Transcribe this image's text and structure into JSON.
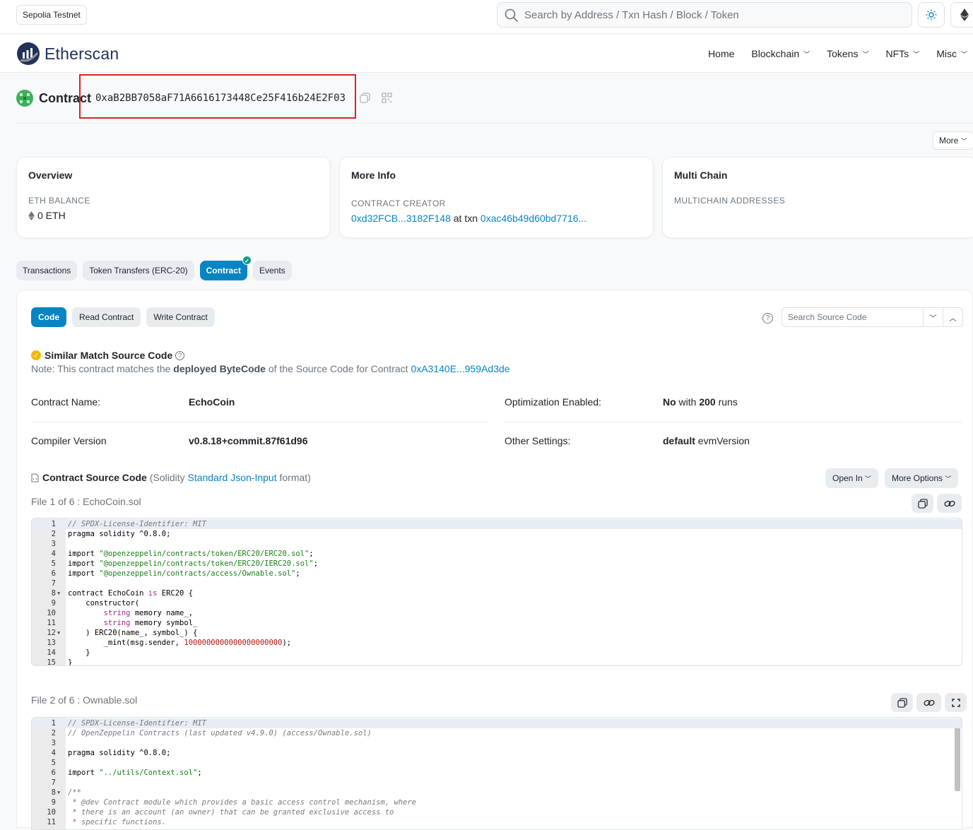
{
  "topbar": {
    "network_badge": "Sepolia Testnet",
    "search_placeholder": "Search by Address / Txn Hash / Block / Token"
  },
  "navbar": {
    "brand": "Etherscan",
    "items": [
      {
        "label": "Home",
        "dropdown": false
      },
      {
        "label": "Blockchain",
        "dropdown": true
      },
      {
        "label": "Tokens",
        "dropdown": true
      },
      {
        "label": "NFTs",
        "dropdown": true
      },
      {
        "label": "Misc",
        "dropdown": true
      }
    ]
  },
  "contract": {
    "title": "Contract",
    "address": "0xaB2BB7058aF71A6616173448Ce25F416b24E2F03",
    "more_label": "More"
  },
  "cards": {
    "overview": {
      "title": "Overview",
      "label": "ETH BALANCE",
      "value": "0 ETH"
    },
    "more_info": {
      "title": "More Info",
      "label": "CONTRACT CREATOR",
      "creator": "0xd32FCB...3182F148",
      "at_txn": "at txn",
      "txn": "0xac46b49d60bd7716..."
    },
    "multi_chain": {
      "title": "Multi Chain",
      "label": "MULTICHAIN ADDRESSES"
    }
  },
  "tabs": [
    "Transactions",
    "Token Transfers (ERC-20)",
    "Contract",
    "Events"
  ],
  "subtabs": [
    "Code",
    "Read Contract",
    "Write Contract"
  ],
  "source_search_placeholder": "Search Source Code",
  "similar": {
    "title": "Similar Match Source Code",
    "note_pre": "Note: This contract matches the ",
    "note_bold": "deployed ByteCode",
    "note_mid": " of the Source Code for Contract ",
    "note_link": "0xA3140E...959Ad3de"
  },
  "details": {
    "contract_name_label": "Contract Name:",
    "contract_name": "EchoCoin",
    "compiler_label": "Compiler Version",
    "compiler": "v0.8.18+commit.87f61d96",
    "optimization_label": "Optimization Enabled:",
    "optimization_value": "No",
    "optimization_with": " with ",
    "optimization_runs": "200",
    "optimization_runs_suffix": " runs",
    "other_label": "Other Settings:",
    "other_bold": "default",
    "other_rest": " evmVersion"
  },
  "source": {
    "title": "Contract Source Code",
    "lang_pre": "(Solidity ",
    "lang_link": "Standard Json-Input",
    "lang_post": " format)",
    "open_in": "Open In",
    "more_options": "More Options",
    "file1_label": "File 1 of 6 : EchoCoin.sol",
    "file2_label": "File 2 of 6 : Ownable.sol"
  },
  "file1_lines": [
    {
      "n": "1",
      "fold": "",
      "hl": true,
      "parts": [
        {
          "t": "// SPDX-License-Identifier: MIT",
          "c": "cm"
        }
      ]
    },
    {
      "n": "2",
      "fold": "",
      "parts": [
        {
          "t": "pragma solidity ",
          "c": ""
        },
        {
          "t": "^0.8.0",
          "c": ""
        },
        {
          "t": ";",
          "c": ""
        }
      ]
    },
    {
      "n": "3",
      "fold": "",
      "parts": []
    },
    {
      "n": "4",
      "fold": "",
      "parts": [
        {
          "t": "import ",
          "c": ""
        },
        {
          "t": "\"@openzeppelin/contracts/token/ERC20/ERC20.sol\"",
          "c": "str"
        },
        {
          "t": ";",
          "c": ""
        }
      ]
    },
    {
      "n": "5",
      "fold": "",
      "parts": [
        {
          "t": "import ",
          "c": ""
        },
        {
          "t": "\"@openzeppelin/contracts/token/ERC20/IERC20.sol\"",
          "c": "str"
        },
        {
          "t": ";",
          "c": ""
        }
      ]
    },
    {
      "n": "6",
      "fold": "",
      "parts": [
        {
          "t": "import ",
          "c": ""
        },
        {
          "t": "\"@openzeppelin/contracts/access/Ownable.sol\"",
          "c": "str"
        },
        {
          "t": ";",
          "c": ""
        }
      ]
    },
    {
      "n": "7",
      "fold": "",
      "parts": []
    },
    {
      "n": "8",
      "fold": "▼",
      "parts": [
        {
          "t": "contract EchoCoin ",
          "c": ""
        },
        {
          "t": "is",
          "c": "kw"
        },
        {
          "t": " ERC20 {",
          "c": ""
        }
      ]
    },
    {
      "n": "9",
      "fold": "",
      "parts": [
        {
          "t": "    constructor(",
          "c": ""
        }
      ]
    },
    {
      "n": "10",
      "fold": "",
      "parts": [
        {
          "t": "        ",
          "c": ""
        },
        {
          "t": "string",
          "c": "kw"
        },
        {
          "t": " memory name_,",
          "c": ""
        }
      ]
    },
    {
      "n": "11",
      "fold": "",
      "parts": [
        {
          "t": "        ",
          "c": ""
        },
        {
          "t": "string",
          "c": "kw"
        },
        {
          "t": " memory symbol_",
          "c": ""
        }
      ]
    },
    {
      "n": "12",
      "fold": "▼",
      "parts": [
        {
          "t": "    ) ERC20(name_, symbol_) {",
          "c": ""
        }
      ]
    },
    {
      "n": "13",
      "fold": "",
      "parts": [
        {
          "t": "        _mint(msg.sender, ",
          "c": ""
        },
        {
          "t": "1000000000000000000000",
          "c": "num"
        },
        {
          "t": ");",
          "c": ""
        }
      ]
    },
    {
      "n": "14",
      "fold": "",
      "parts": [
        {
          "t": "    }",
          "c": ""
        }
      ]
    },
    {
      "n": "15",
      "fold": "",
      "parts": [
        {
          "t": "}",
          "c": ""
        }
      ]
    }
  ],
  "file2_lines": [
    {
      "n": "1",
      "fold": "",
      "hl": true,
      "parts": [
        {
          "t": "// SPDX-License-Identifier: MIT",
          "c": "cm"
        }
      ]
    },
    {
      "n": "2",
      "fold": "",
      "parts": [
        {
          "t": "// OpenZeppelin Contracts (last updated v4.9.0) (access/Ownable.sol)",
          "c": "cm"
        }
      ]
    },
    {
      "n": "3",
      "fold": "",
      "parts": []
    },
    {
      "n": "4",
      "fold": "",
      "parts": [
        {
          "t": "pragma solidity ",
          "c": ""
        },
        {
          "t": "^0.8.0",
          "c": ""
        },
        {
          "t": ";",
          "c": ""
        }
      ]
    },
    {
      "n": "5",
      "fold": "",
      "parts": []
    },
    {
      "n": "6",
      "fold": "",
      "parts": [
        {
          "t": "import ",
          "c": ""
        },
        {
          "t": "\"../utils/Context.sol\"",
          "c": "str"
        },
        {
          "t": ";",
          "c": ""
        }
      ]
    },
    {
      "n": "7",
      "fold": "",
      "parts": []
    },
    {
      "n": "8",
      "fold": "▼",
      "parts": [
        {
          "t": "/**",
          "c": "cm"
        }
      ]
    },
    {
      "n": "9",
      "fold": "",
      "parts": [
        {
          "t": " * @dev Contract module which provides a basic access control mechanism, where",
          "c": "cm"
        }
      ]
    },
    {
      "n": "10",
      "fold": "",
      "parts": [
        {
          "t": " * there is an account (an owner) that can be granted exclusive access to",
          "c": "cm"
        }
      ]
    },
    {
      "n": "11",
      "fold": "",
      "parts": [
        {
          "t": " * specific functions.",
          "c": "cm"
        }
      ]
    }
  ],
  "colors": {
    "accent": "#0784c3",
    "highlight": "#e02020",
    "success": "#00a186",
    "warning": "#f0b90b"
  }
}
